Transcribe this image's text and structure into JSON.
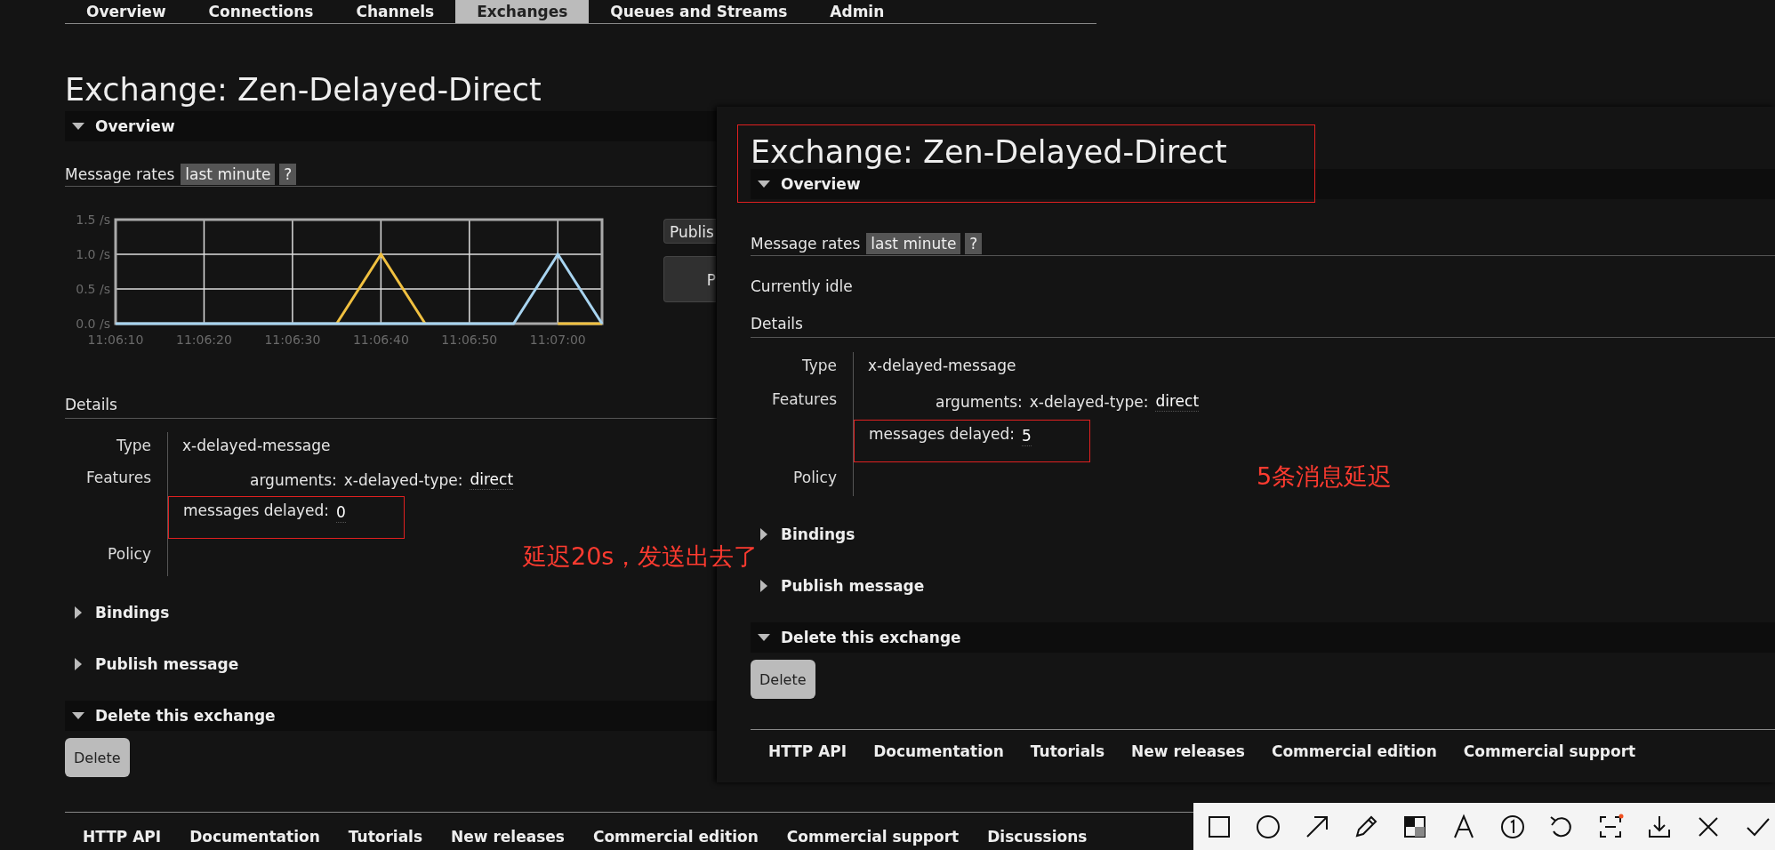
{
  "nav_tabs": [
    {
      "label": "Overview",
      "selected": false
    },
    {
      "label": "Connections",
      "selected": false
    },
    {
      "label": "Channels",
      "selected": false
    },
    {
      "label": "Exchanges",
      "selected": true
    },
    {
      "label": "Queues and Streams",
      "selected": false
    },
    {
      "label": "Admin",
      "selected": false
    }
  ],
  "page": {
    "title": "Exchange: Zen-Delayed-Direct",
    "overview": {
      "label": "Overview",
      "expanded": true
    },
    "rates": {
      "label": "Message rates",
      "range": "last minute",
      "help": "?"
    },
    "chart_data": {
      "type": "line",
      "categories": [
        "11:06:10",
        null,
        "11:06:20",
        null,
        "11:06:30",
        null,
        "11:06:40",
        null,
        "11:06:50",
        null,
        "11:07:00",
        null
      ],
      "ylim": [
        0,
        1.5
      ],
      "yticks": [
        {
          "value": 0,
          "label": "0.0 /s"
        },
        {
          "value": 0.5,
          "label": "0.5 /s"
        },
        {
          "value": 1,
          "label": "1.0 /s"
        },
        {
          "value": 1.5,
          "label": "1.5 /s"
        }
      ],
      "grid": true,
      "series": [
        {
          "color": "#f0c040",
          "values": [
            null,
            null,
            null,
            null,
            null,
            0,
            1,
            0,
            null,
            null,
            0,
            0
          ]
        },
        {
          "color": "#a8d4f0",
          "values": [
            0,
            0,
            0,
            0,
            0,
            0,
            0,
            0,
            0,
            0,
            1,
            0
          ]
        }
      ]
    },
    "side_buttons": [
      "Publis",
      "P"
    ],
    "details": {
      "heading": "Details",
      "type_label": "Type",
      "type_value": "x-delayed-message",
      "features_label": "Features",
      "arguments_key": "arguments:",
      "argument_name": "x-delayed-type:",
      "argument_value": "direct",
      "delayed_key": "messages delayed:",
      "delayed_value": "0",
      "policy_label": "Policy"
    },
    "annotation": "延迟20s，发送出去了",
    "sections": [
      {
        "label": "Bindings",
        "expanded": false
      },
      {
        "label": "Publish message",
        "expanded": false
      },
      {
        "label": "Delete this exchange",
        "expanded": true
      }
    ],
    "delete_button": "Delete",
    "footer_links": [
      "HTTP API",
      "Documentation",
      "Tutorials",
      "New releases",
      "Commercial edition",
      "Commercial support",
      "Discussions"
    ]
  },
  "overlay": {
    "title": "Exchange: Zen-Delayed-Direct",
    "overview": {
      "label": "Overview",
      "expanded": true
    },
    "rates": {
      "label": "Message rates",
      "range": "last minute",
      "help": "?"
    },
    "status": "Currently idle",
    "details": {
      "heading": "Details",
      "type_label": "Type",
      "type_value": "x-delayed-message",
      "features_label": "Features",
      "arguments_key": "arguments:",
      "argument_name": "x-delayed-type:",
      "argument_value": "direct",
      "delayed_key": "messages delayed:",
      "delayed_value": "5",
      "policy_label": "Policy"
    },
    "annotation": "5条消息延迟",
    "sections": [
      {
        "label": "Bindings",
        "expanded": false
      },
      {
        "label": "Publish message",
        "expanded": false
      },
      {
        "label": "Delete this exchange",
        "expanded": true
      }
    ],
    "delete_button": "Delete",
    "footer_links": [
      "HTTP API",
      "Documentation",
      "Tutorials",
      "New releases",
      "Commercial edition",
      "Commercial support"
    ]
  }
}
